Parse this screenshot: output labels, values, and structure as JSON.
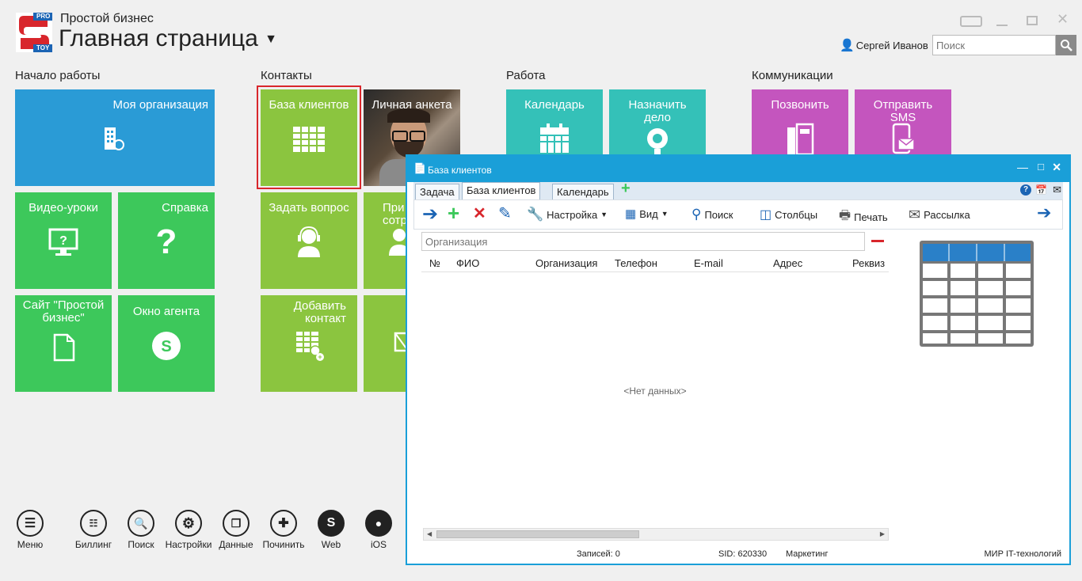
{
  "header": {
    "logo_pro": "PRO",
    "logo_toy": "TOY",
    "app_name": "Простой бизнес",
    "page_title": "Главная страница",
    "user_name": "Сергей Иванов",
    "search_placeholder": "Поиск"
  },
  "sections": {
    "start": "Начало работы",
    "contacts": "Контакты",
    "work": "Работа",
    "communications": "Коммуникации"
  },
  "tiles": {
    "my_org": "Моя организация",
    "video": "Видео-уроки",
    "help": "Справка",
    "site": "Сайт \"Простой бизнес\"",
    "agent": "Окно агента",
    "client_base": "База клиентов",
    "profile": "Личная анкета",
    "ask": "Задать вопрос",
    "invite": "При сотр",
    "add_contact": "Добавить контакт",
    "calendar": "Календарь",
    "assign": "Назначить дело",
    "call": "Позвонить",
    "sms": "Отправить SMS"
  },
  "bottom_bar": [
    {
      "label": "Меню"
    },
    {
      "label": "Биллинг"
    },
    {
      "label": "Поиск"
    },
    {
      "label": "Настройки"
    },
    {
      "label": "Данные"
    },
    {
      "label": "Починить"
    },
    {
      "label": "Web"
    },
    {
      "label": "iOS"
    }
  ],
  "dialog": {
    "title": "База клиентов",
    "tabs": [
      "Задача",
      "База клиентов",
      "Календарь"
    ],
    "toolbar": {
      "settings": "Настройка",
      "view": "Вид",
      "search": "Поиск",
      "columns": "Столбцы",
      "print": "Печать",
      "mailing": "Рассылка"
    },
    "filter_placeholder": "Организация",
    "columns": [
      "№",
      "ФИО",
      "Организация",
      "Телефон",
      "E-mail",
      "Адрес",
      "Реквиз"
    ],
    "empty_text": "<Нет данных>",
    "status": {
      "records": "Записей: 0",
      "sid": "SID: 620330",
      "segment": "Маркетинг",
      "company": "МИР IT-технологий"
    }
  },
  "colors": {
    "blue_tile": "#2a9bd6",
    "green_tile": "#3dc85b",
    "lime_tile": "#8bc53f",
    "purple_tile": "#c455be",
    "dialog_accent": "#1a9fd8",
    "selection_border": "#d8262c"
  }
}
